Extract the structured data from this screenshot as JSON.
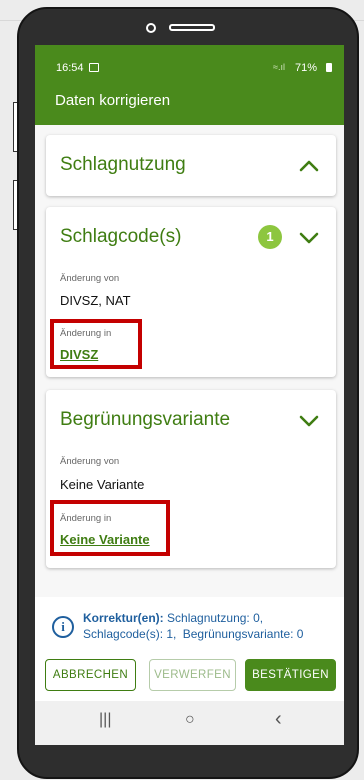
{
  "status_bar": {
    "time": "16:54",
    "signal": "≈.ıl",
    "battery": "71%"
  },
  "app_bar": {
    "title": "Daten korrigieren"
  },
  "cards": {
    "schlagnutzung": {
      "title": "Schlagnutzung"
    },
    "schlagcode": {
      "title": "Schlagcode(s)",
      "badge": "1",
      "from_label": "Änderung von",
      "from_value": "DIVSZ, NAT",
      "to_label": "Änderung in",
      "to_value": "DIVSZ"
    },
    "begruenung": {
      "title": "Begrünungsvariante",
      "from_label": "Änderung von",
      "from_value": "Keine Variante",
      "to_label": "Änderung in",
      "to_value": "Keine Variante"
    }
  },
  "summary": {
    "prefix": "Korrektur(en):",
    "line1": "Schlagnutzung: 0,",
    "line2a": "Schlagcode(s): 1,",
    "line2b": "Begrünungsvariante: 0"
  },
  "buttons": {
    "cancel": "ABBRECHEN",
    "discard": "VERWERFEN",
    "confirm": "BESTÄTIGEN"
  },
  "nav": {
    "recents": "|||",
    "home": "○",
    "back": "‹"
  },
  "colors": {
    "primary": "#4a8a1c",
    "badge": "#8dc63f",
    "highlight": "#c40000",
    "info": "#1f5f9e"
  }
}
